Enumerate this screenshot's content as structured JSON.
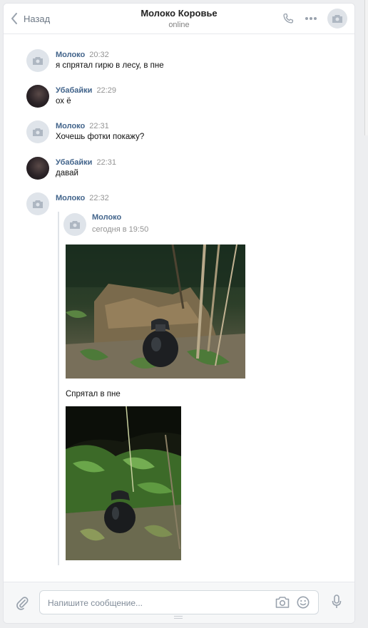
{
  "header": {
    "back_label": "Назад",
    "title": "Молоко Коровье",
    "status": "online"
  },
  "messages": [
    {
      "author": "Молоко",
      "time": "20:32",
      "text": "я спрятал гирю в лесу, в пне",
      "avatar": "camera-icon"
    },
    {
      "author": "Убабайки",
      "time": "22:29",
      "text": "ох ё",
      "avatar": "user-photo"
    },
    {
      "author": "Молоко",
      "time": "22:31",
      "text": "Хочешь фотки покажу?",
      "avatar": "camera-icon"
    },
    {
      "author": "Убабайки",
      "time": "22:31",
      "text": "давай",
      "avatar": "user-photo"
    },
    {
      "author": "Молоко",
      "time": "22:32",
      "text": "",
      "avatar": "camera-icon"
    }
  ],
  "forwarded": {
    "author": "Молоко",
    "date": "сегодня в 19:50",
    "caption": "Спрятал в пне"
  },
  "composer": {
    "placeholder": "Напишите сообщение..."
  },
  "colors": {
    "author": "#42648b",
    "background": "#edeef0",
    "icon": "#818c99"
  }
}
